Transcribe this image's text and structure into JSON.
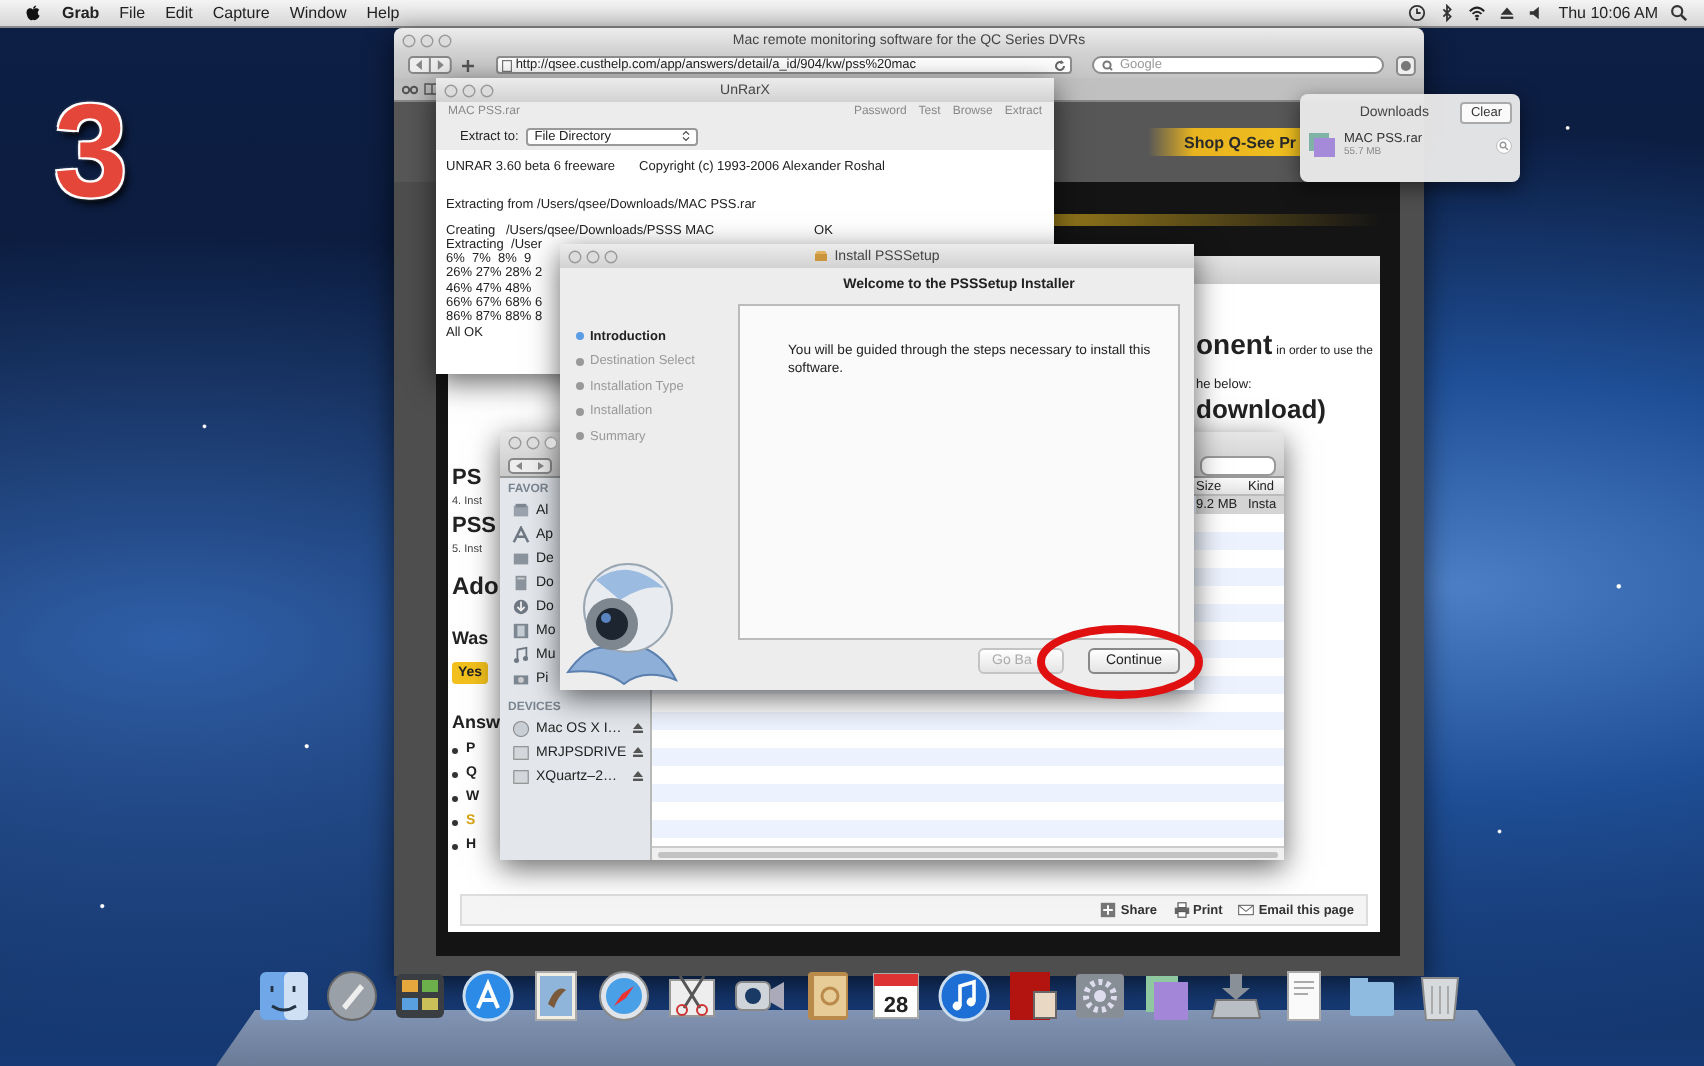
{
  "menu_bar": {
    "app_name": "Grab",
    "menus": [
      "File",
      "Edit",
      "Capture",
      "Window",
      "Help"
    ],
    "clock": "Thu 10:06 AM"
  },
  "step_number": "3",
  "browser": {
    "title": "Mac remote monitoring software for the QC Series DVRs",
    "url": "http://qsee.custhelp.com/app/answers/detail/a_id/904/kw/pss%20mac",
    "search_placeholder": "Google",
    "shop_banner": "Shop Q-See Pr",
    "left_fragments": [
      {
        "kind": "heading",
        "text": "PS"
      },
      {
        "kind": "small",
        "text": "4. Inst"
      },
      {
        "kind": "heading",
        "text": "PSS"
      },
      {
        "kind": "small",
        "text": "5. Inst"
      },
      {
        "kind": "title",
        "text": "Ado"
      },
      {
        "kind": "subheading",
        "text": "Was"
      },
      {
        "kind": "button",
        "text": "Yes"
      },
      {
        "kind": "subheading",
        "text": "Answ"
      },
      {
        "kind": "bullet",
        "text": "P"
      },
      {
        "kind": "bullet",
        "text": "Q"
      },
      {
        "kind": "bullet",
        "text": "W"
      },
      {
        "kind": "link_bullet",
        "text": "S"
      },
      {
        "kind": "bullet",
        "text": "H"
      }
    ],
    "component_heading": "onent",
    "component_note": "in order to use the",
    "below_text": "he below:",
    "download_heading": "download)",
    "share_bar": [
      {
        "kind": "share",
        "label": "Share"
      },
      {
        "kind": "print",
        "label": "Print"
      },
      {
        "kind": "email",
        "label": "Email this page"
      }
    ]
  },
  "downloads_popover": {
    "title": "Downloads",
    "clear_button": "Clear",
    "items": [
      {
        "name": "MAC PSS.rar",
        "size": "55.7 MB"
      }
    ]
  },
  "unrarx": {
    "title": "UnRarX",
    "archive": "MAC PSS.rar",
    "toolbar": [
      "Password",
      "Test",
      "Browse",
      "Extract"
    ],
    "extract_label": "Extract to:",
    "extract_target": "File Directory",
    "log": [
      {
        "kind": "header",
        "text": "UNRAR 3.60 beta 6 freeware",
        "tail": "Copyright (c) 1993-2006 Alexander Roshal"
      },
      {
        "kind": "para",
        "text": "Extracting from /Users/qsee/Downloads/MAC PSS.rar"
      },
      {
        "kind": "status",
        "text": "Creating   /Users/qsee/Downloads/PSSS MAC",
        "tail": "OK"
      },
      {
        "kind": "line",
        "text": "Extracting  /User"
      },
      {
        "kind": "line",
        "text": "6%  7%  8%  9"
      },
      {
        "kind": "line",
        "text": "26% 27% 28% 2"
      },
      {
        "kind": "line",
        "text": "46% 47% 48%"
      },
      {
        "kind": "line",
        "text": "66% 67% 68% 6"
      },
      {
        "kind": "line",
        "text": "86% 87% 88% 8"
      },
      {
        "kind": "line",
        "text": "All OK"
      }
    ]
  },
  "installer": {
    "title": "Install PSSSetup",
    "heading": "Welcome to the PSSSetup Installer",
    "steps": [
      {
        "label": "Introduction",
        "selected": true
      },
      {
        "label": "Destination Select",
        "selected": false
      },
      {
        "label": "Installation Type",
        "selected": false
      },
      {
        "label": "Installation",
        "selected": false
      },
      {
        "label": "Summary",
        "selected": false
      }
    ],
    "body": "You will be guided through the steps necessary to install this software.",
    "buttons": [
      {
        "label": "Go Ba",
        "disabled": true
      },
      {
        "label": "Continue",
        "disabled": false
      }
    ]
  },
  "finder": {
    "sections": [
      {
        "header": "FAVOR",
        "items": [
          {
            "kind": "files",
            "label": "Al"
          },
          {
            "kind": "apps",
            "label": "Ap"
          },
          {
            "kind": "desktop",
            "label": "De"
          },
          {
            "kind": "documents",
            "label": "Do"
          },
          {
            "kind": "downloads",
            "label": "Do"
          },
          {
            "kind": "movies",
            "label": "Mo"
          },
          {
            "kind": "music",
            "label": "Mu"
          },
          {
            "kind": "pictures",
            "label": "Pi"
          }
        ]
      },
      {
        "header": "DEVICES",
        "items": [
          {
            "kind": "disc",
            "label": "Mac OS X I…",
            "ejectable": true
          },
          {
            "kind": "drive",
            "label": "MRJPSDRIVE",
            "ejectable": true
          },
          {
            "kind": "drive",
            "label": "XQuartz–2…",
            "ejectable": true
          }
        ]
      }
    ],
    "columns": [
      "Size",
      "Kind"
    ],
    "rows": [
      {
        "size": "9.2 MB",
        "kind": "Insta",
        "selected": true
      }
    ]
  },
  "dock": {
    "calendar_day": "28"
  }
}
